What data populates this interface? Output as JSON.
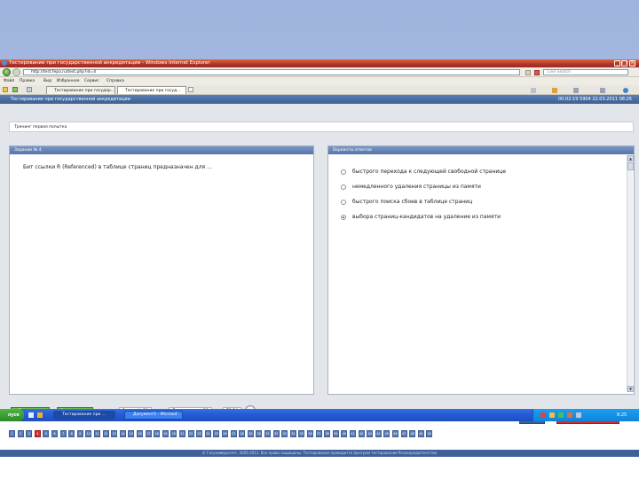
{
  "window": {
    "title": "Тестирование при государственной аккредитации - Windows Internet Explorer",
    "address": "http://test.fepo.ru/test.php?id=4",
    "search_placeholder": "Live Search",
    "controls": [
      "_",
      "□",
      "×"
    ]
  },
  "menu": [
    "Файл",
    "Правка",
    "Вид",
    "Избранное",
    "Сервис",
    "Справка"
  ],
  "tabs": [
    "Тестирование при государ...",
    "Тестирование при госуд..."
  ],
  "page": {
    "header_title": "Тестирование при государственной аккредитации",
    "header_time": "00:02:19 5904 22.03.2011 08:25",
    "training_label": "Тренинг первая попытка",
    "question": {
      "header": "Задание № 4.",
      "text": "Бит ссылки R (Referenced) в таблице страниц предназначен для …"
    },
    "answers": {
      "header": "Варианты ответов",
      "options": [
        {
          "text": "быстрого перехода к следующей свободной странице",
          "selected": false
        },
        {
          "text": "немедленного удаления страницы из памяти",
          "selected": false
        },
        {
          "text": "быстрого поиска сбоев в таблице страниц",
          "selected": false
        },
        {
          "text": "выбора страниц-кандидатов на удаление из памяти",
          "selected": true
        }
      ]
    },
    "controls": {
      "prev_label": "◄ Предыдущее",
      "next_label": "Следующее ►",
      "tasks_label": "Заданий: 50",
      "answered_label": "Дано ответов: 50",
      "time": "73:54",
      "help_label": "Помощь",
      "finish_label": "Завершить тестирование"
    },
    "footer": "© Госуниверситет, 2005-2011. Все права защищены. Тестирование проводится Центром тестирования Росаккредагентства",
    "question_numbers": [
      "1",
      "2",
      "3",
      "4",
      "5",
      "6",
      "7",
      "8",
      "9",
      "10",
      "11",
      "12",
      "13",
      "14",
      "15",
      "16",
      "17",
      "18",
      "19",
      "20",
      "21",
      "22",
      "23",
      "24",
      "25",
      "26",
      "27",
      "28",
      "29",
      "30",
      "31",
      "32",
      "33",
      "34",
      "35",
      "36",
      "37",
      "38",
      "39",
      "40",
      "41",
      "42",
      "43",
      "44",
      "45",
      "46",
      "47",
      "48",
      "49",
      "50"
    ],
    "current_question": "4"
  },
  "taskbar": {
    "start_label": "пуск",
    "tasks": [
      "Тестирование при ...",
      "Документ1 - Microsof..."
    ],
    "tray_time": "8:25"
  },
  "colors": {
    "title_bar": "#b0342a",
    "page_header": "#3c5f93",
    "green_button": "#3c8f26",
    "help_button": "#3f6199",
    "finish_button": "#d03030"
  }
}
